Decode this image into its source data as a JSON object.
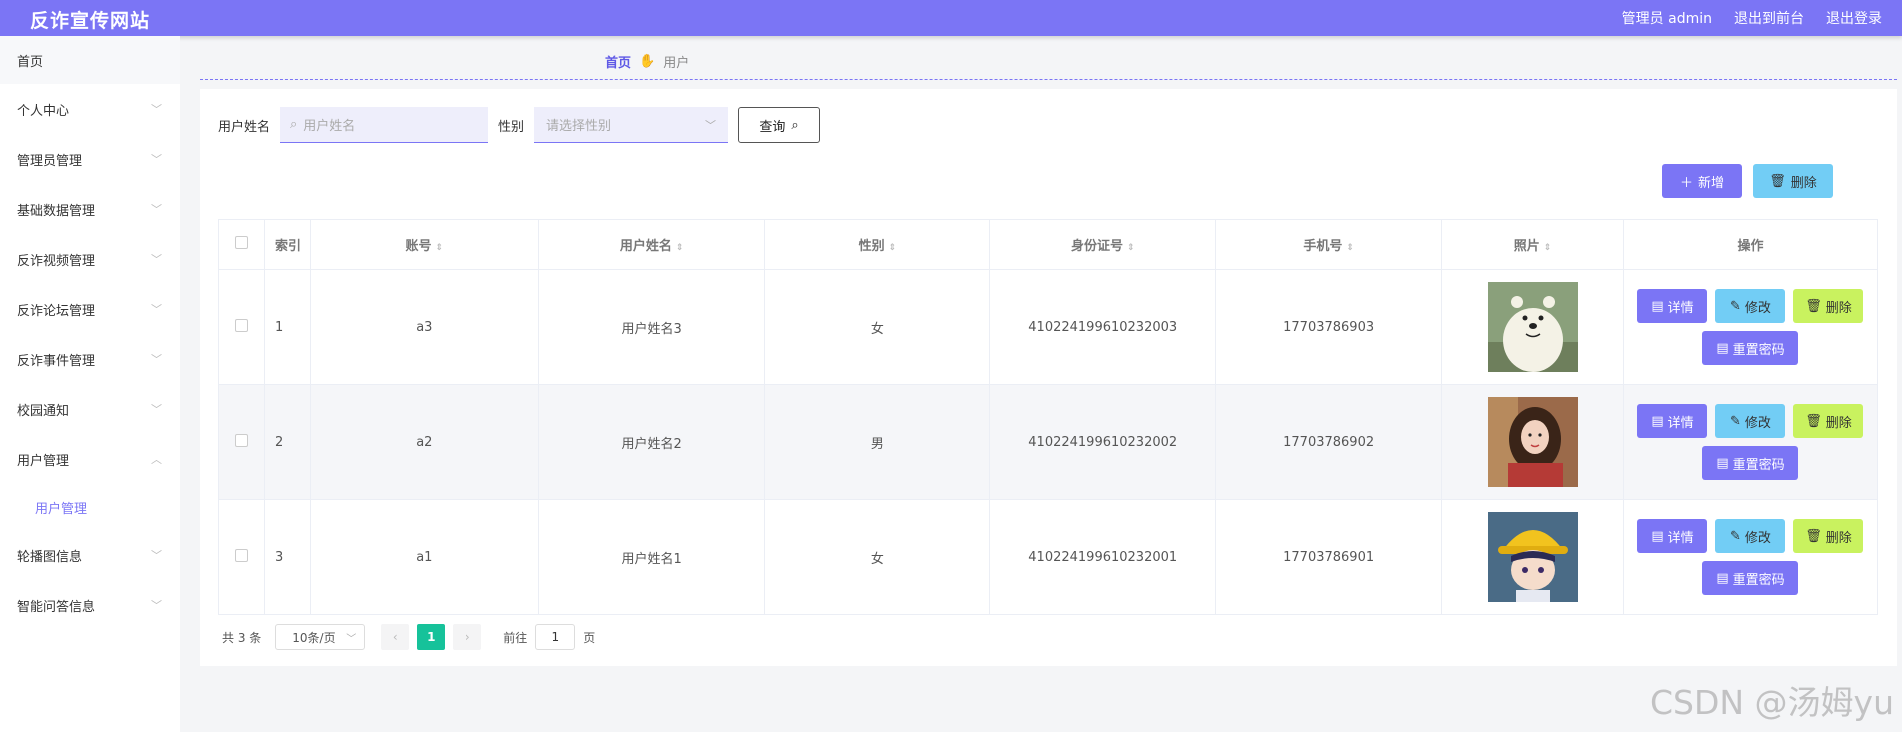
{
  "header": {
    "title": "反诈宣传网站",
    "admin_label": "管理员 admin",
    "to_front": "退出到前台",
    "logout": "退出登录"
  },
  "sidebar": {
    "items": [
      {
        "label": "首页"
      },
      {
        "label": "个人中心"
      },
      {
        "label": "管理员管理"
      },
      {
        "label": "基础数据管理"
      },
      {
        "label": "反诈视频管理"
      },
      {
        "label": "反诈论坛管理"
      },
      {
        "label": "反诈事件管理"
      },
      {
        "label": "校园通知"
      },
      {
        "label": "用户管理"
      },
      {
        "label": "轮播图信息"
      },
      {
        "label": "智能问答信息"
      }
    ],
    "sub_item": "用户管理"
  },
  "breadcrumb": {
    "home": "首页",
    "current": "用户"
  },
  "search": {
    "name_label": "用户姓名",
    "name_placeholder": "用户姓名",
    "gender_label": "性别",
    "gender_placeholder": "请选择性别",
    "query_button": "查询"
  },
  "actions": {
    "add": "新增",
    "delete": "删除"
  },
  "table": {
    "headers": {
      "index": "索引",
      "account": "账号",
      "name": "用户姓名",
      "gender": "性别",
      "id_card": "身份证号",
      "phone": "手机号",
      "photo": "照片",
      "ops": "操作"
    },
    "rows": [
      {
        "index": "1",
        "account": "a3",
        "name": "用户姓名3",
        "gender": "女",
        "id_card": "410224199610232003",
        "phone": "17703786903",
        "photo": "polar-bear-cartoon"
      },
      {
        "index": "2",
        "account": "a2",
        "name": "用户姓名2",
        "gender": "男",
        "id_card": "410224199610232002",
        "phone": "17703786902",
        "photo": "girl-portrait"
      },
      {
        "index": "3",
        "account": "a1",
        "name": "用户姓名1",
        "gender": "女",
        "id_card": "410224199610232001",
        "phone": "17703786901",
        "photo": "anime-boy-yellow-hat"
      }
    ],
    "op_labels": {
      "detail": "详情",
      "edit": "修改",
      "delete": "删除",
      "reset": "重置密码"
    }
  },
  "pagination": {
    "total": "共 3 条",
    "page_size": "10条/页",
    "current_page": "1",
    "goto_label": "前往",
    "goto_value": "1",
    "page_suffix": "页"
  },
  "watermark": "CSDN @汤姆yu",
  "colors": {
    "primary": "#7b75f5",
    "info": "#72cdf5",
    "warn": "#c9f25f",
    "page_active": "#16c29a"
  }
}
